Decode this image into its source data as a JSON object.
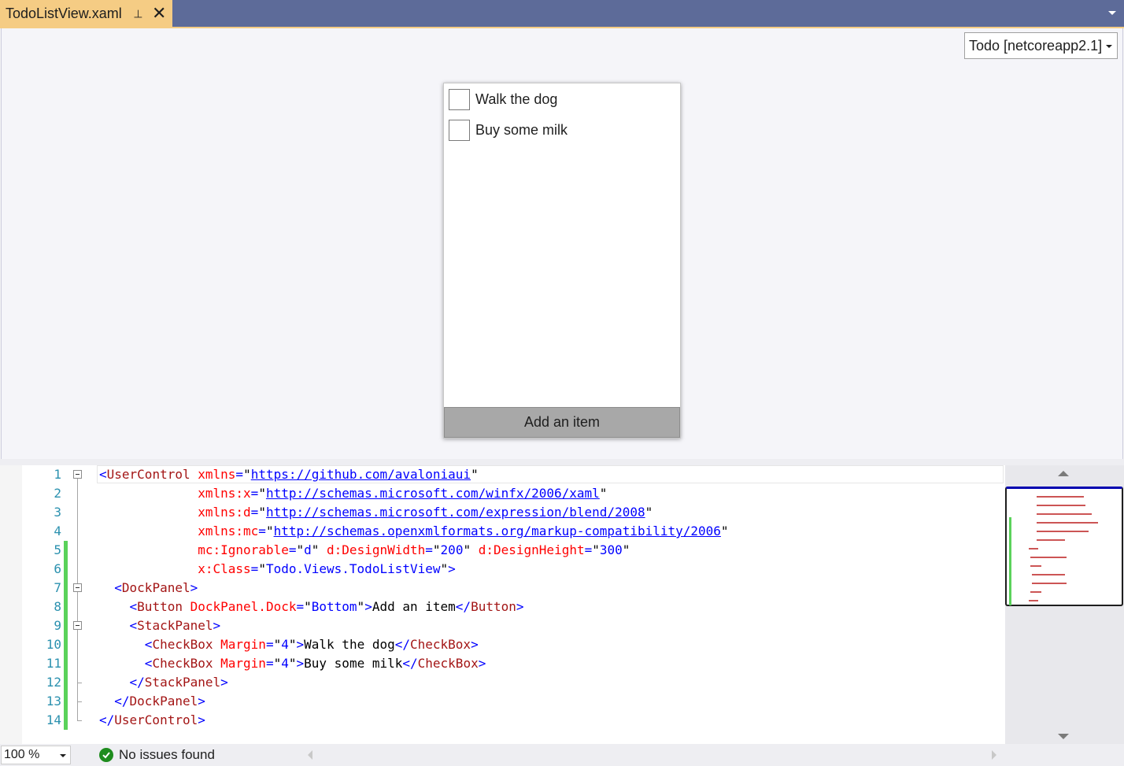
{
  "tab": {
    "title": "TodoListView.xaml",
    "pin_glyph": "⊣",
    "close_glyph": "✕"
  },
  "target_dropdown": {
    "value": "Todo [netcoreapp2.1]"
  },
  "preview": {
    "checkboxes": [
      {
        "label": "Walk the dog",
        "checked": false
      },
      {
        "label": "Buy some milk",
        "checked": false
      }
    ],
    "button_label": "Add an item"
  },
  "code": {
    "line_numbers": [
      "1",
      "2",
      "3",
      "4",
      "5",
      "6",
      "7",
      "8",
      "9",
      "10",
      "11",
      "12",
      "13",
      "14"
    ],
    "changed_lines": [
      5,
      6,
      7,
      8,
      9,
      10,
      11,
      12,
      13,
      14
    ],
    "lines": [
      [
        [
          "p",
          "<"
        ],
        [
          "e",
          "UserControl"
        ],
        [
          "t",
          " "
        ],
        [
          "a",
          "xmlns"
        ],
        [
          "p",
          "="
        ],
        [
          "t",
          "\""
        ],
        [
          "u",
          "https://github.com/avaloniaui"
        ],
        [
          "t",
          "\""
        ]
      ],
      [
        [
          "t",
          "             "
        ],
        [
          "a",
          "xmlns:x"
        ],
        [
          "p",
          "="
        ],
        [
          "t",
          "\""
        ],
        [
          "u",
          "http://schemas.microsoft.com/winfx/2006/xaml"
        ],
        [
          "t",
          "\""
        ]
      ],
      [
        [
          "t",
          "             "
        ],
        [
          "a",
          "xmlns:d"
        ],
        [
          "p",
          "="
        ],
        [
          "t",
          "\""
        ],
        [
          "u",
          "http://schemas.microsoft.com/expression/blend/2008"
        ],
        [
          "t",
          "\""
        ]
      ],
      [
        [
          "t",
          "             "
        ],
        [
          "a",
          "xmlns:mc"
        ],
        [
          "p",
          "="
        ],
        [
          "t",
          "\""
        ],
        [
          "u",
          "http://schemas.openxmlformats.org/markup-compatibility/2006"
        ],
        [
          "t",
          "\""
        ]
      ],
      [
        [
          "t",
          "             "
        ],
        [
          "a",
          "mc:Ignorable"
        ],
        [
          "p",
          "="
        ],
        [
          "t",
          "\""
        ],
        [
          "v",
          "d"
        ],
        [
          "t",
          "\""
        ],
        [
          "t",
          " "
        ],
        [
          "a",
          "d:DesignWidth"
        ],
        [
          "p",
          "="
        ],
        [
          "t",
          "\""
        ],
        [
          "v",
          "200"
        ],
        [
          "t",
          "\""
        ],
        [
          "t",
          " "
        ],
        [
          "a",
          "d:DesignHeight"
        ],
        [
          "p",
          "="
        ],
        [
          "t",
          "\""
        ],
        [
          "v",
          "300"
        ],
        [
          "t",
          "\""
        ]
      ],
      [
        [
          "t",
          "             "
        ],
        [
          "a",
          "x:Class"
        ],
        [
          "p",
          "="
        ],
        [
          "t",
          "\""
        ],
        [
          "v",
          "Todo.Views.TodoListView"
        ],
        [
          "t",
          "\""
        ],
        [
          "p",
          ">"
        ]
      ],
      [
        [
          "t",
          "  "
        ],
        [
          "p",
          "<"
        ],
        [
          "e",
          "DockPanel"
        ],
        [
          "p",
          ">"
        ]
      ],
      [
        [
          "t",
          "    "
        ],
        [
          "p",
          "<"
        ],
        [
          "e",
          "Button"
        ],
        [
          "t",
          " "
        ],
        [
          "a",
          "DockPanel.Dock"
        ],
        [
          "p",
          "="
        ],
        [
          "t",
          "\""
        ],
        [
          "v",
          "Bottom"
        ],
        [
          "t",
          "\""
        ],
        [
          "p",
          ">"
        ],
        [
          "t",
          "Add an item"
        ],
        [
          "p",
          "</"
        ],
        [
          "e",
          "Button"
        ],
        [
          "p",
          ">"
        ]
      ],
      [
        [
          "t",
          "    "
        ],
        [
          "p",
          "<"
        ],
        [
          "e",
          "StackPanel"
        ],
        [
          "p",
          ">"
        ]
      ],
      [
        [
          "t",
          "      "
        ],
        [
          "p",
          "<"
        ],
        [
          "e",
          "CheckBox"
        ],
        [
          "t",
          " "
        ],
        [
          "a",
          "Margin"
        ],
        [
          "p",
          "="
        ],
        [
          "t",
          "\""
        ],
        [
          "v",
          "4"
        ],
        [
          "t",
          "\""
        ],
        [
          "p",
          ">"
        ],
        [
          "t",
          "Walk the dog"
        ],
        [
          "p",
          "</"
        ],
        [
          "e",
          "CheckBox"
        ],
        [
          "p",
          ">"
        ]
      ],
      [
        [
          "t",
          "      "
        ],
        [
          "p",
          "<"
        ],
        [
          "e",
          "CheckBox"
        ],
        [
          "t",
          " "
        ],
        [
          "a",
          "Margin"
        ],
        [
          "p",
          "="
        ],
        [
          "t",
          "\""
        ],
        [
          "v",
          "4"
        ],
        [
          "t",
          "\""
        ],
        [
          "p",
          ">"
        ],
        [
          "t",
          "Buy some milk"
        ],
        [
          "p",
          "</"
        ],
        [
          "e",
          "CheckBox"
        ],
        [
          "p",
          ">"
        ]
      ],
      [
        [
          "t",
          "    "
        ],
        [
          "p",
          "</"
        ],
        [
          "e",
          "StackPanel"
        ],
        [
          "p",
          ">"
        ]
      ],
      [
        [
          "t",
          "  "
        ],
        [
          "p",
          "</"
        ],
        [
          "e",
          "DockPanel"
        ],
        [
          "p",
          ">"
        ]
      ],
      [
        [
          "p",
          "</"
        ],
        [
          "e",
          "UserControl"
        ],
        [
          "p",
          ">"
        ]
      ]
    ]
  },
  "status": {
    "zoom": "100 %",
    "issues": "No issues found"
  },
  "colors": {
    "title_bar": "#5d6b99",
    "active_tab": "#f5cc84",
    "change_marker": "#5ad25a",
    "status_ok": "#1e8c1e"
  }
}
